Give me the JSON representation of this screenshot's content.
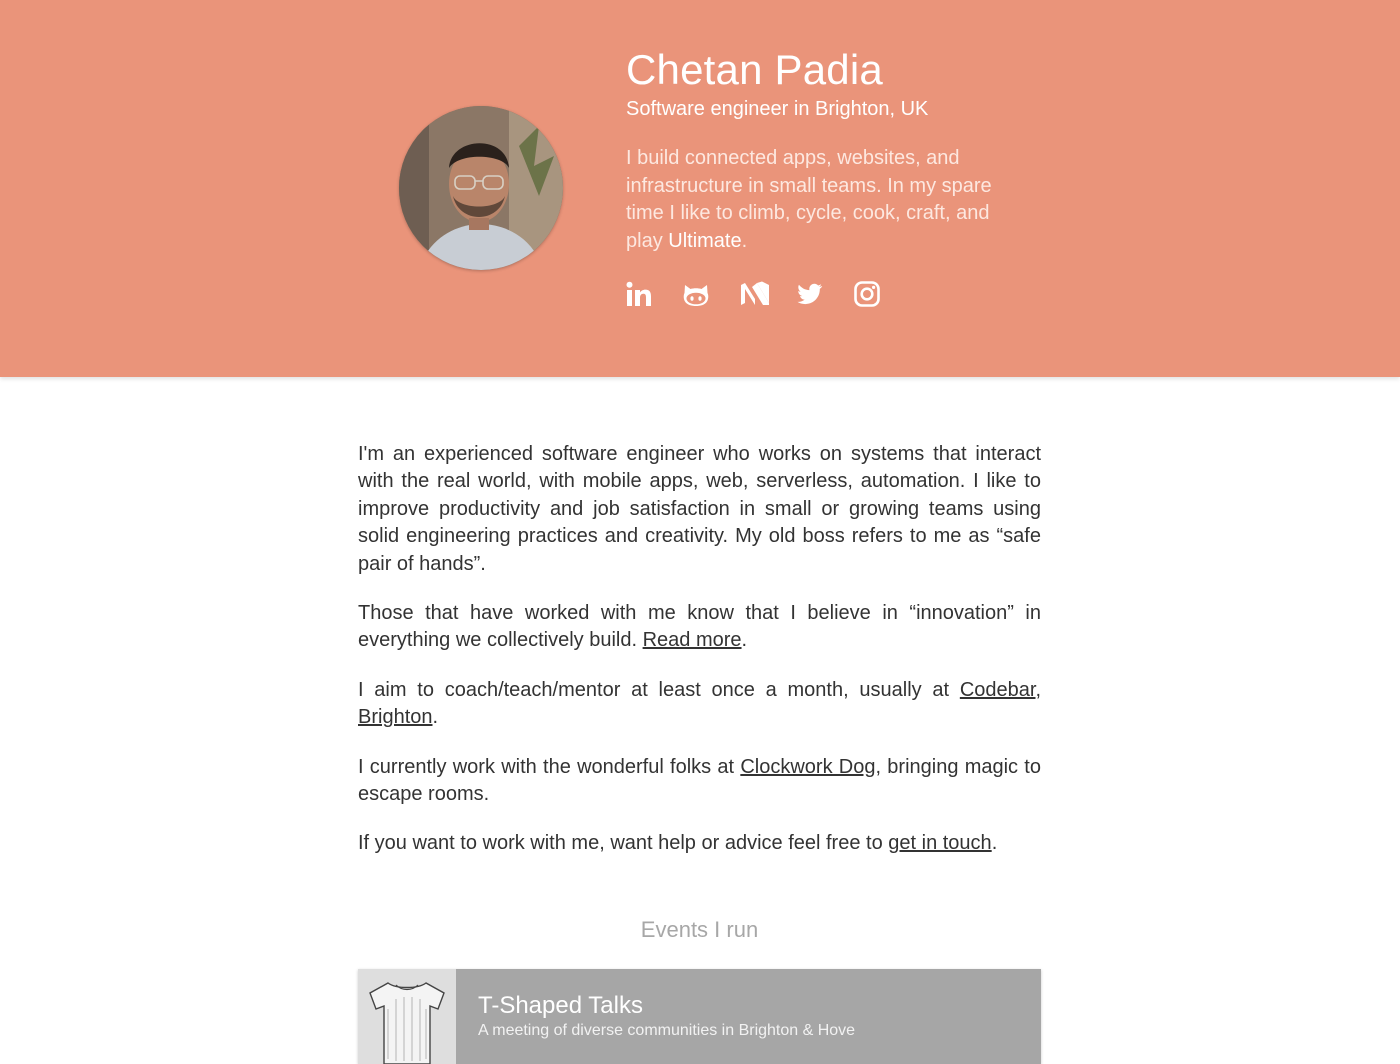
{
  "header": {
    "name": "Chetan Padia",
    "tagline": "Software engineer in Brighton, UK",
    "bio_prefix": "I build connected apps, websites, and infrastructure in small teams. In my spare time I like to climb, cycle, cook, craft, and play ",
    "bio_highlight": "Ultimate",
    "bio_suffix": ".",
    "socials": [
      {
        "icon": "linkedin-icon"
      },
      {
        "icon": "github-icon"
      },
      {
        "icon": "medium-icon"
      },
      {
        "icon": "twitter-icon"
      },
      {
        "icon": "instagram-icon"
      }
    ],
    "background_color": "#ea947a"
  },
  "content": {
    "p1": "I'm an experienced software engineer who works on systems that interact with the real world, with mobile apps, web, serverless, automation. I like to improve productivity and job satisfaction in small or growing teams using solid engineering practices and creativity. My old boss refers to me as “safe pair of hands”.",
    "p2_prefix": "Those that have worked with me know that I believe in “innovation” in everything we collectively build. ",
    "p2_link": "Read more",
    "p2_suffix": ".",
    "p3_prefix": "I aim to coach/teach/mentor at least once a month, usually at ",
    "p3_link": "Codebar, Brighton",
    "p3_suffix": ".",
    "p4_prefix": "I currently work with the wonderful folks at ",
    "p4_link": "Clockwork Dog",
    "p4_suffix": ", bringing magic to escape rooms.",
    "p5_prefix": "If you want to work with me, want help or advice feel free to ",
    "p5_link": "get in touch",
    "p5_suffix": "."
  },
  "events": {
    "title": "Events I run",
    "items": [
      {
        "name": "T-Shaped Talks",
        "description": "A meeting of diverse communities in Brighton & Hove"
      }
    ]
  }
}
